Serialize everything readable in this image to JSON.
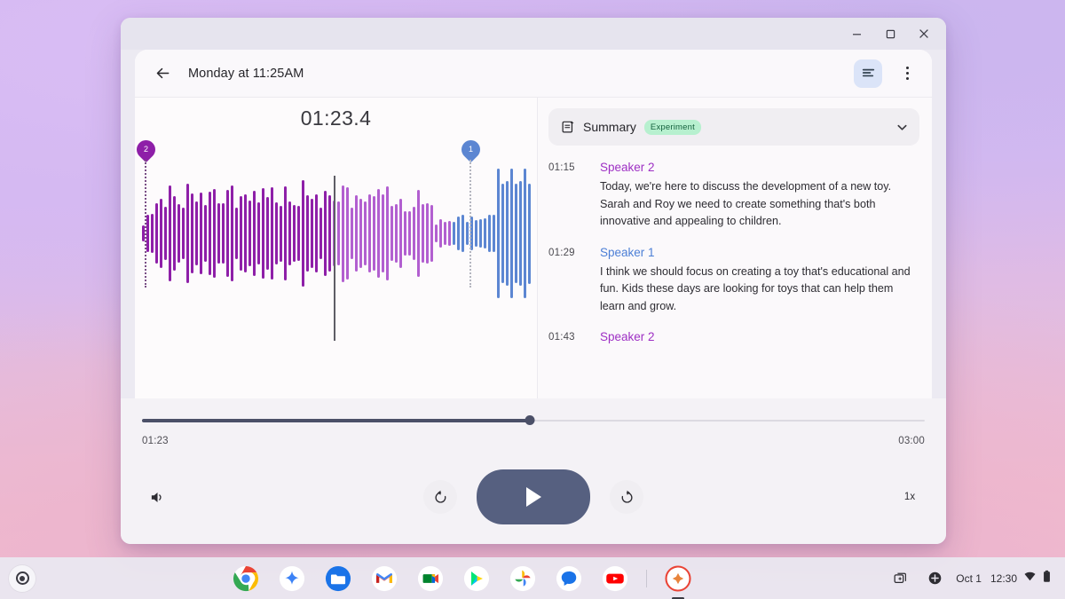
{
  "window": {
    "controls": [
      {
        "name": "minimize",
        "label": "Minimize"
      },
      {
        "name": "maximize",
        "label": "Maximize"
      },
      {
        "name": "close",
        "label": "Close"
      }
    ]
  },
  "header": {
    "back_label": "Back",
    "title": "Monday at 11:25AM",
    "notes_toggle_label": "Transcript",
    "overflow_label": "More options"
  },
  "waveform": {
    "current_time": "01:23.4",
    "markers": [
      {
        "id": "2",
        "label": "2",
        "color": "#8e1fa8",
        "left_pct": 2.4
      },
      {
        "id": "1",
        "label": "1",
        "color": "#5c86d2",
        "left_pct": 81.5
      }
    ],
    "playhead_pct": 48.5,
    "colors": {
      "past": "#8e1fa8",
      "current": "#b25fd0",
      "upcoming": "#5c86d2"
    }
  },
  "summary": {
    "icon": "summary-doc-icon",
    "label": "Summary",
    "badge": "Experiment",
    "chevron": "chevron-down-icon"
  },
  "transcript": {
    "entries": [
      {
        "time": "01:15",
        "speaker": "Speaker 2",
        "speaker_class": "sp2",
        "text": "Today, we're here to discuss the development of a new toy. Sarah and Roy we need to create something that's both innovative and appealing to children."
      },
      {
        "time": "01:29",
        "speaker": "Speaker 1",
        "speaker_class": "sp1",
        "text": "I think we should focus on creating a toy that's educational and fun. Kids these days are looking for toys that can help them learn and grow."
      },
      {
        "time": "01:43",
        "speaker": "Speaker 2",
        "speaker_class": "sp2",
        "text": ""
      }
    ]
  },
  "player": {
    "elapsed": "01:23",
    "duration": "03:00",
    "progress_pct": 49.5,
    "volume_label": "Volume",
    "rewind_label": "Replay 10 seconds",
    "play_label": "Play",
    "forward_label": "Forward 10 seconds",
    "speed": "1x"
  },
  "shelf": {
    "launcher_label": "Launcher",
    "apps": [
      {
        "name": "chrome",
        "label": "Chrome"
      },
      {
        "name": "gemini",
        "label": "Gemini"
      },
      {
        "name": "files",
        "label": "Files"
      },
      {
        "name": "gmail",
        "label": "Gmail"
      },
      {
        "name": "meet",
        "label": "Google Meet"
      },
      {
        "name": "play-store",
        "label": "Play Store"
      },
      {
        "name": "photos",
        "label": "Google Photos"
      },
      {
        "name": "messages",
        "label": "Messages"
      },
      {
        "name": "youtube",
        "label": "YouTube"
      },
      {
        "name": "recorder",
        "label": "Recorder"
      }
    ],
    "status": {
      "desks_label": "Desks",
      "quick_settings_label": "Quick settings",
      "date": "Oct 1",
      "time": "12:30",
      "wifi_label": "Wi-Fi",
      "battery_label": "Battery"
    }
  }
}
